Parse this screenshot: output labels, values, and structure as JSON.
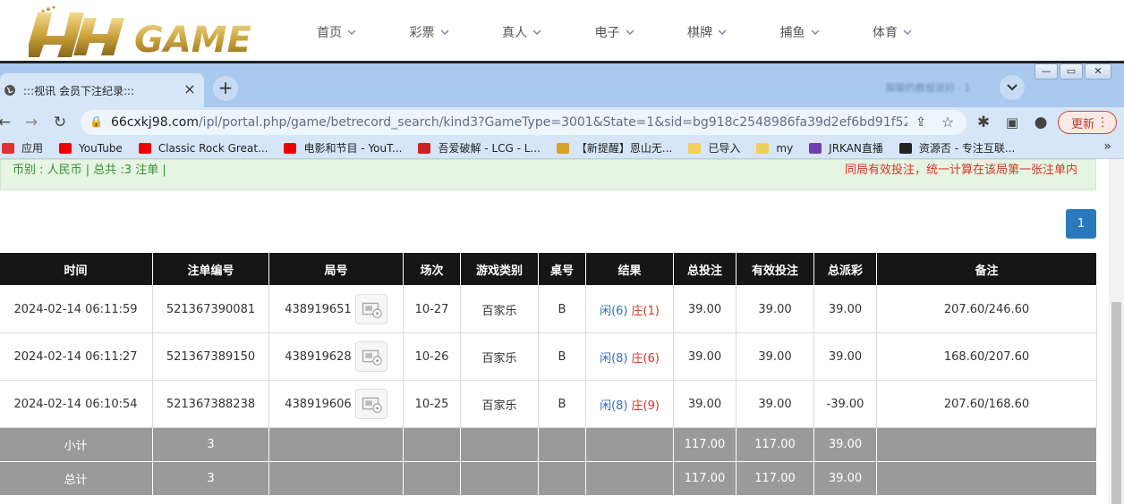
{
  "site": {
    "logo_text": "HH GAME",
    "nav": [
      "首页",
      "彩票",
      "真人",
      "电子",
      "棋牌",
      "捕鱼",
      "体育"
    ]
  },
  "browser": {
    "tab_title": ":::视讯 会员下注纪录:::",
    "tab_close": "×",
    "new_tab": "+",
    "blurred_tab_text": "聊聊的教程说好 · 1",
    "url_domain": "66cxkj98.com",
    "url_path": "/ipl/portal.php/game/betrecord_search/kind3?GameType=3001&State=1&sid=bg918c2548986fa39d2ef6bd91f5221...",
    "update_label": "更新",
    "bookmarks": [
      {
        "label": "应用",
        "icon": "apps-icon",
        "color": "#d33"
      },
      {
        "label": "YouTube",
        "icon": "youtube-icon",
        "color": "#e00"
      },
      {
        "label": "Classic Rock Great...",
        "icon": "youtube-icon",
        "color": "#e00"
      },
      {
        "label": "电影和节目 - YouT...",
        "icon": "youtube-icon",
        "color": "#e00"
      },
      {
        "label": "吾爱破解 - LCG - L...",
        "icon": "site-icon",
        "color": "#c22"
      },
      {
        "label": "【新提醒】恩山无...",
        "icon": "site-icon",
        "color": "#d9a02a"
      },
      {
        "label": "已导入",
        "icon": "folder-icon",
        "color": "#f1cf5b"
      },
      {
        "label": "my",
        "icon": "folder-icon",
        "color": "#f1cf5b"
      },
      {
        "label": "JRKAN直播",
        "icon": "site-icon",
        "color": "#6d3fb0"
      },
      {
        "label": "资源否 - 专注互联...",
        "icon": "site-icon",
        "color": "#222"
      }
    ],
    "bookmarks_more": "»"
  },
  "page": {
    "info_left": "币别 : 人民币 | 总共 :3 注单 |",
    "info_right": "同局有效投注，统一计算在该局第一张注单内",
    "current_page": "1",
    "table": {
      "headers": [
        "时间",
        "注单编号",
        "局号",
        "场次",
        "游戏类别",
        "桌号",
        "结果",
        "总投注",
        "有效投注",
        "总派彩",
        "备注"
      ],
      "rows": [
        {
          "time": "2024-02-14 06:11:59",
          "bet_id": "521367390081",
          "round": "438919651",
          "session": "10-27",
          "game": "百家乐",
          "table": "B",
          "player": "闲(6)",
          "banker": "庄(1)",
          "total_bet": "39.00",
          "valid_bet": "39.00",
          "payout": "39.00",
          "payout_negative": false,
          "note": "207.60/246.60"
        },
        {
          "time": "2024-02-14 06:11:27",
          "bet_id": "521367389150",
          "round": "438919628",
          "session": "10-26",
          "game": "百家乐",
          "table": "B",
          "player": "闲(8)",
          "banker": "庄(6)",
          "total_bet": "39.00",
          "valid_bet": "39.00",
          "payout": "39.00",
          "payout_negative": false,
          "note": "168.60/207.60"
        },
        {
          "time": "2024-02-14 06:10:54",
          "bet_id": "521367388238",
          "round": "438919606",
          "session": "10-25",
          "game": "百家乐",
          "table": "B",
          "player": "闲(8)",
          "banker": "庄(9)",
          "total_bet": "39.00",
          "valid_bet": "39.00",
          "payout": "-39.00",
          "payout_negative": true,
          "note": "207.60/168.60"
        }
      ],
      "subtotal": {
        "label": "小计",
        "count": "3",
        "total_bet": "117.00",
        "valid_bet": "117.00",
        "payout": "39.00"
      },
      "total": {
        "label": "总计",
        "count": "3",
        "total_bet": "117.00",
        "valid_bet": "117.00",
        "payout": "39.00"
      }
    }
  },
  "colors": {
    "header_bg": "#161616",
    "summary_bg": "#9a9a9a",
    "link_blue": "#2a6fc0",
    "negative_red": "#d9332b",
    "info_green_bg": "#e5f5e1",
    "logo_gold": "#c9a13b"
  }
}
